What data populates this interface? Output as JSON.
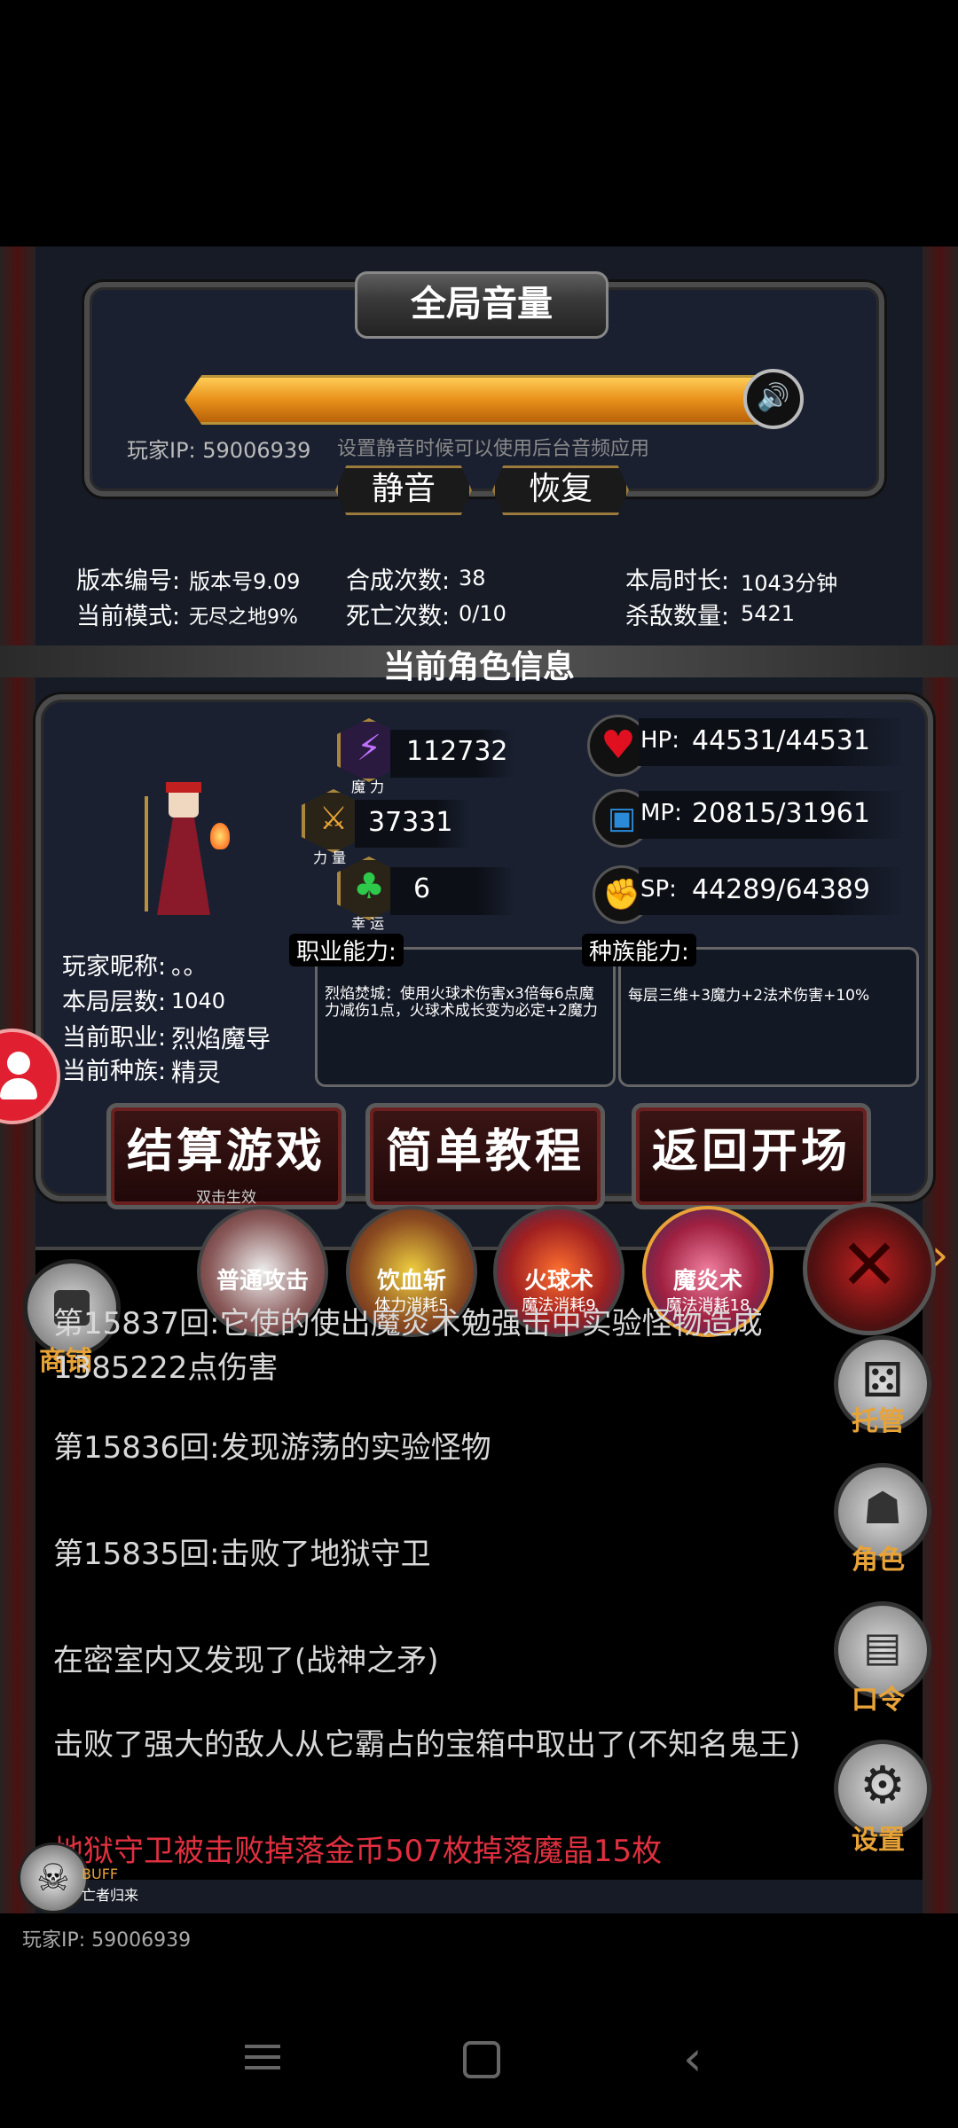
{
  "volume": {
    "title": "全局音量",
    "player_ip": "玩家IP: 59006939",
    "hint": "设置静音时候可以使用后台音频应用",
    "mute_label": "静音",
    "restore_label": "恢复",
    "level": 1.0
  },
  "stats": {
    "version_label": "版本编号:",
    "version_value": "版本号9.09",
    "mode_label": "当前模式:",
    "mode_value": "无尽之地9%",
    "synth_label": "合成次数:",
    "synth_value": "38",
    "death_label": "死亡次数:",
    "death_value": "0/10",
    "duration_label": "本局时长:",
    "duration_value": "1043分钟",
    "kills_label": "杀敌数量:",
    "kills_value": "5421"
  },
  "character": {
    "section_title": "当前角色信息",
    "magic_value": "112732",
    "magic_label": "魔 力",
    "strength_value": "37331",
    "strength_label": "力 量",
    "luck_value": "6",
    "luck_label": "幸 运",
    "hp_label": "HP:",
    "hp_value": "44531/44531",
    "mp_label": "MP:",
    "mp_value": "20815/31961",
    "sp_label": "SP:",
    "sp_value": "44289/64389",
    "nickname_label": "玩家昵称:",
    "nickname_value": "。。",
    "floors_label": "本局层数:",
    "floors_value": "1040",
    "class_label": "当前职业:",
    "class_value": "烈焰魔导",
    "race_label": "当前种族:",
    "race_value": "精灵",
    "class_ability_title": "职业能力:",
    "class_ability_text": "烈焰焚城：使用火球术伤害x3倍每6点魔力减伤1点，火球术成长变为必定+2魔力",
    "race_ability_title": "种族能力:",
    "race_ability_text": "每层三维+3魔力+2法术伤害+10%"
  },
  "actions": {
    "settle_label": "结算游戏",
    "settle_sub": "双击生效",
    "tutorial_label": "简单教程",
    "return_label": "返回开场"
  },
  "skills": [
    {
      "name": "普通攻击",
      "cost": ""
    },
    {
      "name": "饮血斩",
      "cost": "体力消耗5"
    },
    {
      "name": "火球术",
      "cost": "魔法消耗9"
    },
    {
      "name": "魔炎术",
      "cost": "魔法消耗18"
    }
  ],
  "sidebar": {
    "shop_label": "商铺",
    "auto_label": "托管",
    "role_label": "角色",
    "code_label": "口令",
    "settings_label": "设置"
  },
  "log": [
    "第15837回:它使的使出魔炎术勉强击中实验怪物造成1385222点伤害",
    "第15836回:发现游荡的实验怪物",
    "第15835回:击败了地狱守卫",
    "在密室内又发现了(战神之矛)",
    "击败了强大的敌人从它霸占的宝箱中取出了(不知名鬼王)",
    "地狱守卫被击败掉落金币507枚掉落魔晶15枚"
  ],
  "bottom": {
    "buff_label": "BUFF",
    "buff_name": "亡者归来",
    "player_ip": "玩家IP: 59006939"
  },
  "colors": {
    "gold": "#e8a338",
    "bar": "#f0a020",
    "dark_red": "#6b2020"
  }
}
